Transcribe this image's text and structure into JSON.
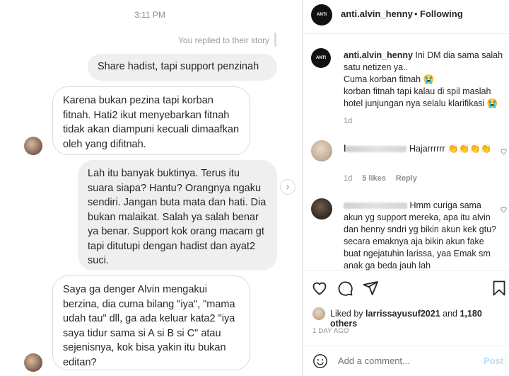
{
  "dm": {
    "time": "3:11 PM",
    "replied_label": "You replied to their story",
    "messages": [
      {
        "from": "me",
        "text": "Share hadist, tapi support penzinah"
      },
      {
        "from": "them",
        "text": "Karena bukan pezina tapi korban fitnah. Hati2 ikut menyebarkan fitnah tidak akan diampuni kecuali dimaafkan oleh yang difitnah."
      },
      {
        "from": "me",
        "text": "Lah itu banyak buktinya. Terus itu suara siapa? Hantu? Orangnya ngaku sendiri. Jangan buta mata dan hati. Dia bukan malaikat. Salah ya salah benar ya benar. Support kok orang macam gt tapi ditutupi dengan hadist dan ayat2 suci."
      },
      {
        "from": "them",
        "text": "Saya ga denger Alvin mengakui berzina, dia cuma bilang \"iya\", \"mama udah tau\" dll, ga ada keluar kata2 \"iya saya tidur sama si A si B si C\" atau sejenisnya, kok bisa yakin itu bukan editan?"
      }
    ],
    "next_arrow": "›"
  },
  "post": {
    "logo_text": "ANTI",
    "username": "anti.alvin_henny",
    "dot": "•",
    "follow_label": "Following",
    "caption_user": "anti.alvin_henny",
    "caption_line1": " Ini DM dia sama salah satu netizen ya..",
    "caption_line2": "Cuma korban fitnah 😭",
    "caption_line3": "korban fitnah tapi kalau di spil maslah hotel junjungan nya selalu klarifikasi 😭",
    "caption_time": "1d",
    "comments": [
      {
        "user_visible": "l",
        "text": " Hajarrrrrr 👏👏👏👏",
        "time": "1d",
        "likes": "5 likes",
        "reply": "Reply"
      },
      {
        "user_visible": "",
        "text": " Hmm curiga sama akun yg support mereka, apa itu alvin dan henny sndri yg bikin akun kek gtu? secara emaknya aja bikin akun fake buat ngejatuhin larissa, yaa Emak sm anak ga beda jauh lah"
      }
    ],
    "liked_by_prefix": "Liked by ",
    "liked_by_user": "larrissayusuf2021",
    "liked_by_mid": " and ",
    "liked_by_count": "1,180 others",
    "date": "1 DAY AGO",
    "add_placeholder": "Add a comment...",
    "post_label": "Post"
  },
  "icons": [
    "heart-icon",
    "comment-icon",
    "share-icon",
    "bookmark-icon",
    "emoji-icon",
    "chevron-right-icon"
  ],
  "colors": {
    "link_disabled": "#b2dffc",
    "muted": "#8e8e8e",
    "bubble_me": "#efefef"
  }
}
